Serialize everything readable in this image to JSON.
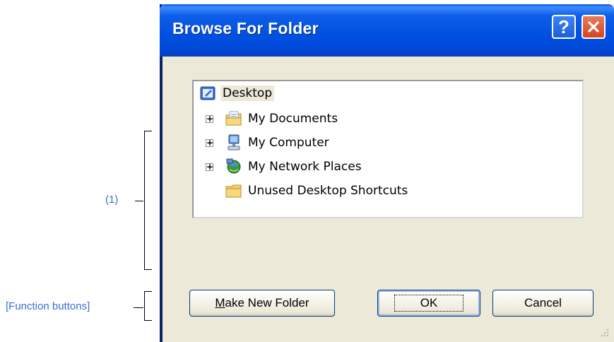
{
  "window": {
    "title": "Browse For Folder",
    "help_label": "?",
    "close_label": "X"
  },
  "tree": {
    "items": [
      {
        "label": "Desktop",
        "icon": "desktop-icon",
        "selected": true
      },
      {
        "label": "My Documents",
        "icon": "my-documents-folder-icon",
        "expandable": true
      },
      {
        "label": "My Computer",
        "icon": "my-computer-icon",
        "expandable": true
      },
      {
        "label": "My Network Places",
        "icon": "network-places-icon",
        "expandable": true
      },
      {
        "label": "Unused Desktop Shortcuts",
        "icon": "folder-icon"
      }
    ]
  },
  "buttons": {
    "make_new_folder_prefix": "M",
    "make_new_folder_rest": "ake New Folder",
    "ok": "OK",
    "cancel": "Cancel"
  },
  "annotations": {
    "tree_label": "(1)",
    "buttons_label": "[Function buttons]"
  },
  "colors": {
    "title_bar": "#0054e3",
    "dialog_bg": "#ece9d8",
    "annotation_text": "#3a6fd0"
  }
}
